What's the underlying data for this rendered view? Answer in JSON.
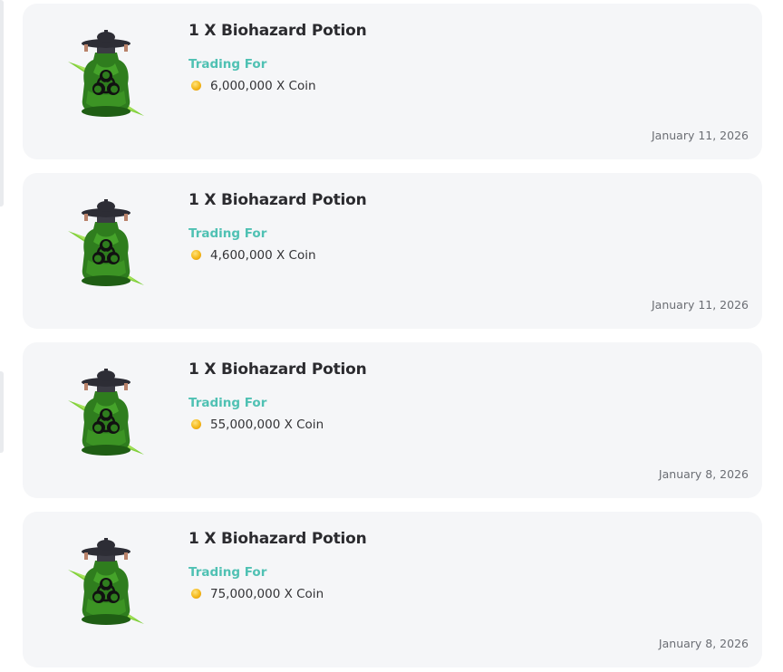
{
  "listings": [
    {
      "title": "1 X Biohazard Potion",
      "trading_label": "Trading For",
      "price": "6,000,000 X Coin",
      "date": "January 11, 2026",
      "item_icon": "biohazard-potion-icon",
      "currency_icon": "coin-icon"
    },
    {
      "title": "1 X Biohazard Potion",
      "trading_label": "Trading For",
      "price": "4,600,000 X Coin",
      "date": "January 11, 2026",
      "item_icon": "biohazard-potion-icon",
      "currency_icon": "coin-icon"
    },
    {
      "title": "1 X Biohazard Potion",
      "trading_label": "Trading For",
      "price": "55,000,000 X Coin",
      "date": "January 8, 2026",
      "item_icon": "biohazard-potion-icon",
      "currency_icon": "coin-icon"
    },
    {
      "title": "1 X Biohazard Potion",
      "trading_label": "Trading For",
      "price": "75,000,000 X Coin",
      "date": "January 8, 2026",
      "item_icon": "biohazard-potion-icon",
      "currency_icon": "coin-icon"
    }
  ],
  "colors": {
    "card_background": "#f5f6f8",
    "title": "#2b2b2f",
    "trading_label": "#4fc1b3",
    "date": "#6b6e74",
    "coin": "#f4b81a"
  }
}
